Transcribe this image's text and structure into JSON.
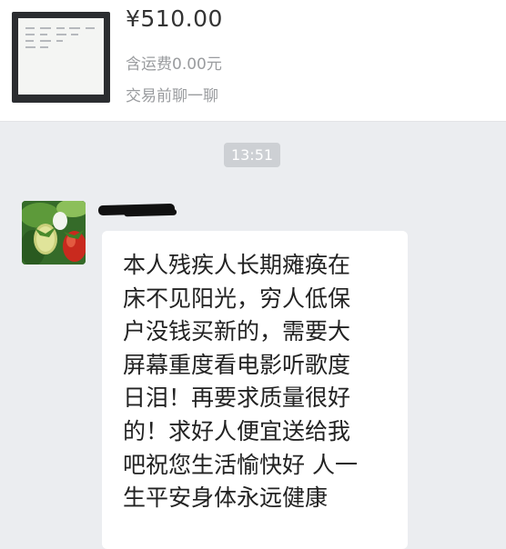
{
  "product": {
    "price": "¥510.00",
    "shipping": "含运费0.00元",
    "chat_before_trade": "交易前聊一聊"
  },
  "chat": {
    "time": "13:51",
    "message_lines": [
      "本人残疾人长期瘫痪在",
      "床不见阳光，穷人低保",
      "户没钱买新的，需要大",
      "屏幕重度看电影听歌度",
      "日泪！再要求质量很好",
      "的！求好人便宜送给我",
      "吧祝您生活愉快好 人一",
      "生平安身体永远健康"
    ]
  },
  "icons": {
    "avatar": "strawberry-avatar-icon",
    "product_thumbnail": "monitor-thumbnail-icon"
  },
  "colors": {
    "chat_background": "#ebedf0",
    "timestamp_badge": "#cdd0d4",
    "bubble": "#ffffff",
    "secondary_text": "#9a9c9f"
  }
}
